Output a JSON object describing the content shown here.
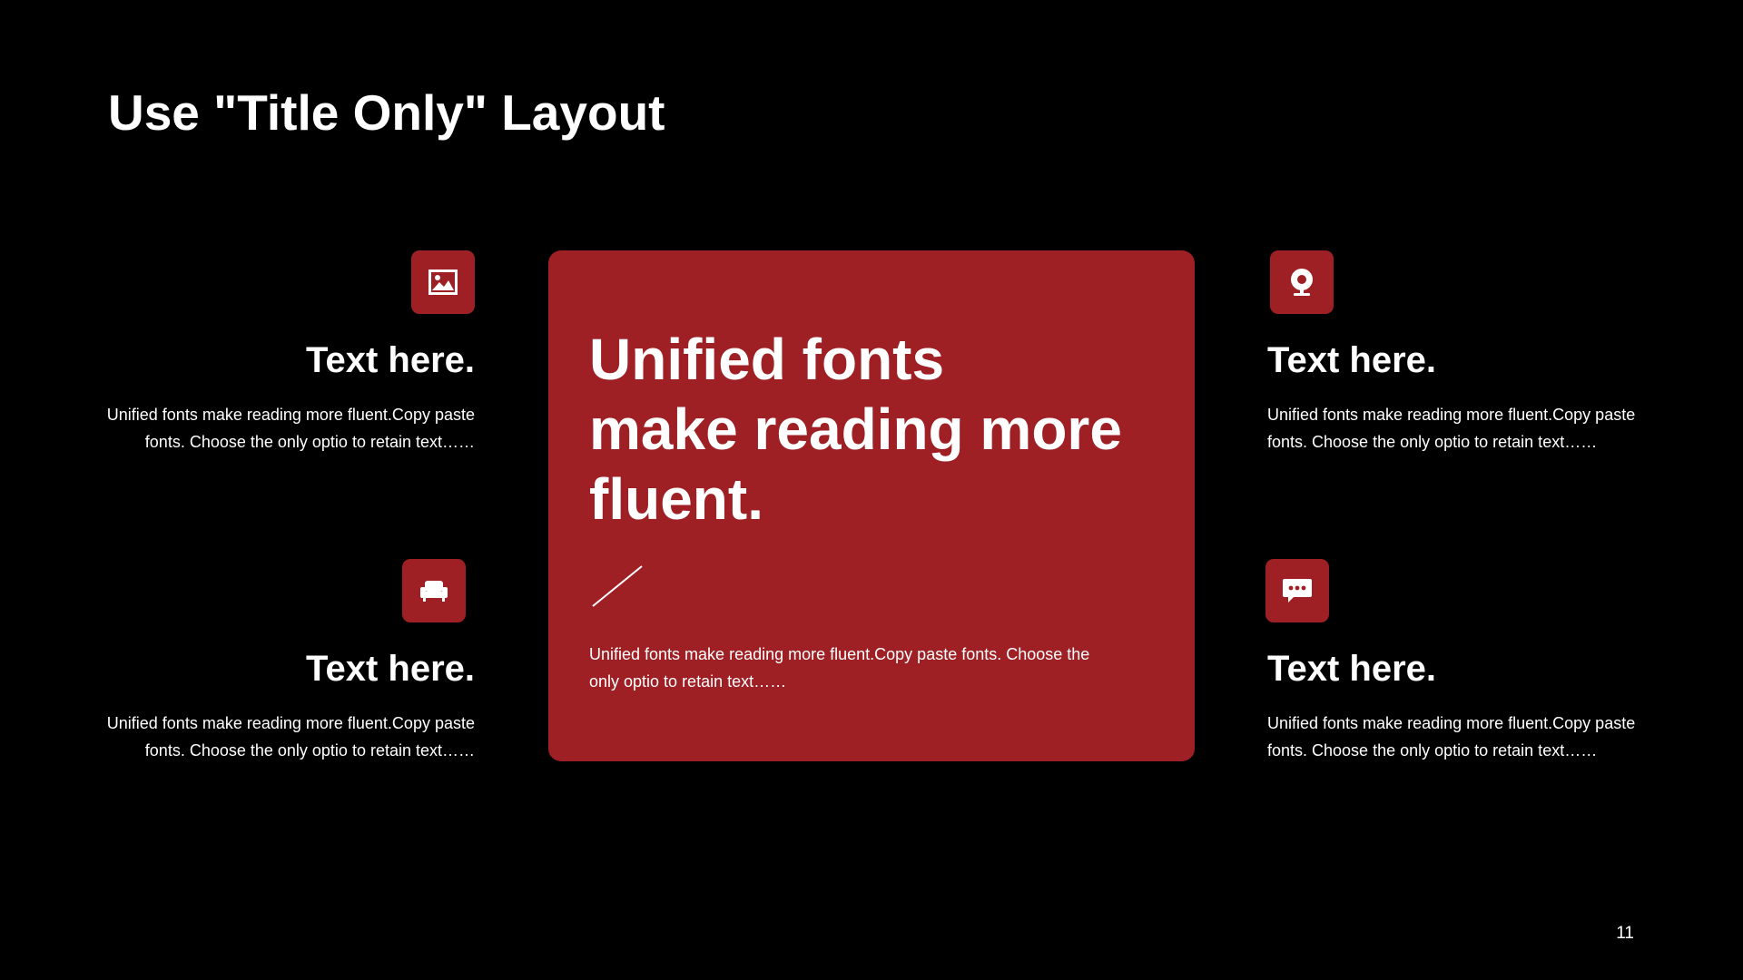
{
  "slide": {
    "title": "Use \"Title Only\" Layout",
    "page_number": "11",
    "colors": {
      "background": "#000000",
      "accent": "#9e1f24",
      "text": "#ffffff"
    }
  },
  "center_card": {
    "headline_lines": [
      "Unified fonts",
      "make reading more",
      "fluent."
    ],
    "body_lines": [
      "Unified fonts make reading more fluent.Copy paste fonts. Choose the",
      "only optio to retain text……"
    ]
  },
  "features": [
    {
      "icon": "image-icon",
      "heading": "Text here.",
      "body_lines": [
        "Unified fonts make reading more fluent.Copy paste",
        "fonts. Choose the only optio to retain text……"
      ]
    },
    {
      "icon": "armchair-icon",
      "heading": "Text here.",
      "body_lines": [
        "Unified fonts make reading more fluent.Copy paste",
        "fonts. Choose the only optio to retain text……"
      ]
    },
    {
      "icon": "webcam-icon",
      "heading": "Text here.",
      "body_lines": [
        "Unified fonts make reading more fluent.Copy paste",
        "fonts. Choose the only optio to retain text……"
      ]
    },
    {
      "icon": "chat-bubble-icon",
      "heading": "Text here.",
      "body_lines": [
        "Unified fonts make reading more fluent.Copy paste",
        "fonts. Choose the only optio to retain text……"
      ]
    }
  ]
}
